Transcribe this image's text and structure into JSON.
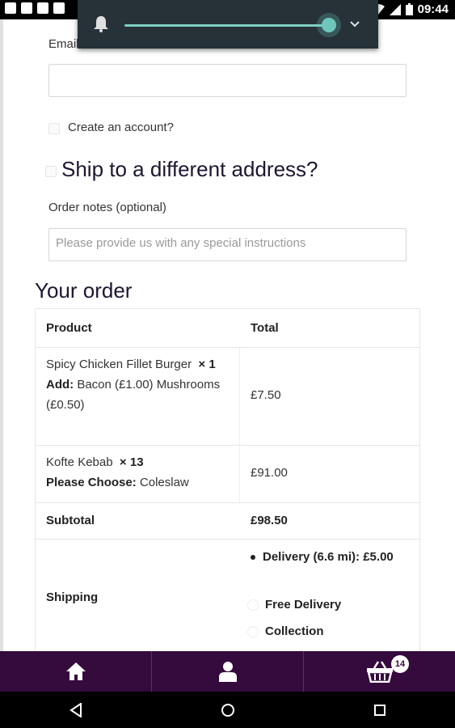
{
  "status_bar": {
    "time": "09:44",
    "icons": [
      "notification-icon",
      "android-icon",
      "facebook-icon",
      "facebook-icon"
    ]
  },
  "volume": {
    "level": 1.0
  },
  "form": {
    "email_label": "Email",
    "create_account_label": "Create an account?",
    "ship_heading": "Ship to a different address?",
    "notes_label": "Order notes (optional)",
    "notes_placeholder": "Please provide us with any special instructions"
  },
  "order": {
    "heading": "Your order",
    "headers": {
      "product": "Product",
      "total": "Total"
    },
    "items": [
      {
        "name": "Spicy Chicken Fillet Burger",
        "qty": "× 1",
        "addon_label": "Add:",
        "addon_value": "Bacon (£1.00) Mushrooms (£0.50)",
        "total": "£7.50"
      },
      {
        "name": "Kofte Kebab",
        "qty": "× 13",
        "addon_label": "Please Choose:",
        "addon_value": "Coleslaw",
        "total": "£91.00"
      }
    ],
    "subtotal_label": "Subtotal",
    "subtotal_value": "£98.50",
    "shipping_label": "Shipping",
    "shipping_options": [
      {
        "label": "Delivery (6.6 mi): £5.00",
        "selected": true
      },
      {
        "label": "Free Delivery",
        "selected": false
      },
      {
        "label": "Collection",
        "selected": false
      }
    ]
  },
  "bottom_nav": {
    "cart_count": "14"
  }
}
